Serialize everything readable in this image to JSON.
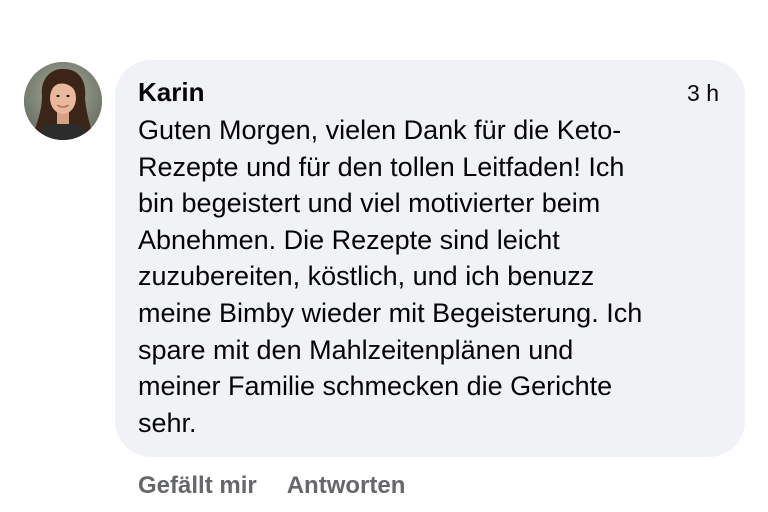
{
  "comment": {
    "author": "Karin",
    "timestamp": "3 h",
    "text_lines": [
      "Guten Morgen, vielen Dank für die Keto-",
      "Rezepte und für den tollen Leitfaden! Ich",
      "bin begeistert und viel motivierter beim",
      "Abnehmen. Die Rezepte sind leicht",
      "zuzubereiten, köstlich, und ich benuzz",
      "meine Bimby wieder mit Begeisterung. Ich",
      "spare mit den Mahlzeitenplänen und",
      "meiner Familie schmecken die Gerichte",
      "sehr."
    ]
  },
  "actions": {
    "like_label": "Gefällt mir",
    "reply_label": "Antworten"
  },
  "colors": {
    "bubble_bg": "#f0f2f5",
    "action_text": "#65676b",
    "body_text": "#050505"
  },
  "icons": {
    "avatar": "profile-photo"
  }
}
